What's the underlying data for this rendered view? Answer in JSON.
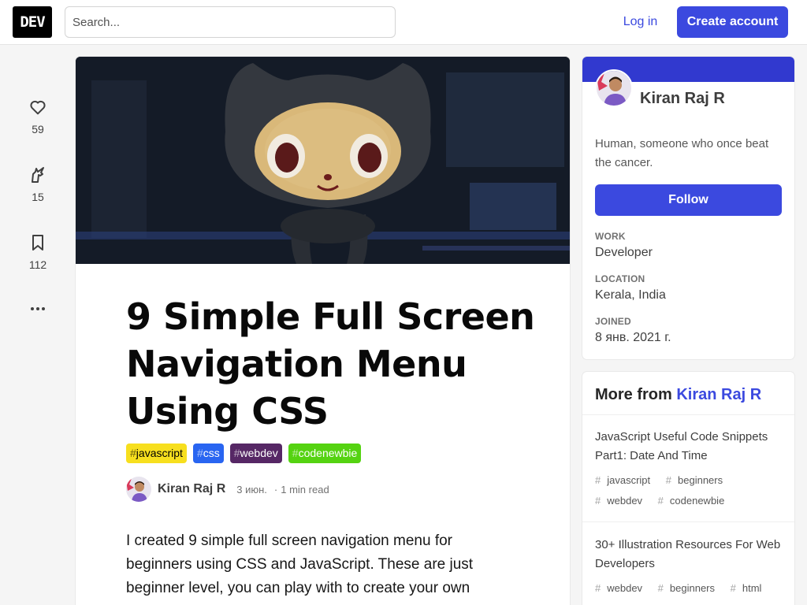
{
  "header": {
    "logo_text": "DEV",
    "search_placeholder": "Search...",
    "login_label": "Log in",
    "create_account_label": "Create account"
  },
  "reactions": {
    "hearts": "59",
    "unicorns": "15",
    "bookmarks": "112"
  },
  "article": {
    "title": "9 Simple Full Screen Navigation Menu Using CSS",
    "tags": [
      "javascript",
      "css",
      "webdev",
      "codenewbie"
    ],
    "tag_prefix": "#",
    "author": "Kiran Raj R",
    "date": "3 июн.",
    "read_time": "1 min read",
    "meta_separator": "·",
    "body_excerpt": "I created 9 simple full screen navigation menu for beginners using CSS and JavaScript. These are just beginner level, you can play with to create your own"
  },
  "profile": {
    "name": "Kiran Raj R",
    "bio": "Human, someone who once beat the cancer.",
    "follow_label": "Follow",
    "work_label": "WORK",
    "work_value": "Developer",
    "location_label": "LOCATION",
    "location_value": "Kerala, India",
    "joined_label": "JOINED",
    "joined_value": "8 янв. 2021 г."
  },
  "more_from": {
    "heading": "More from",
    "author": "Kiran Raj R",
    "posts": [
      {
        "title": "JavaScript Useful Code Snippets Part1: Date And Time",
        "tags": [
          "javascript",
          "beginners",
          "webdev",
          "codenewbie"
        ]
      },
      {
        "title": "30+ Illustration Resources For Web Developers",
        "tags": [
          "webdev",
          "beginners",
          "html"
        ]
      }
    ]
  },
  "colors": {
    "accent": "#3b49df",
    "tag_javascript": "#f7df1e",
    "tag_css": "#2965f1",
    "tag_webdev": "#562765",
    "tag_codenewbie": "#55d311"
  }
}
